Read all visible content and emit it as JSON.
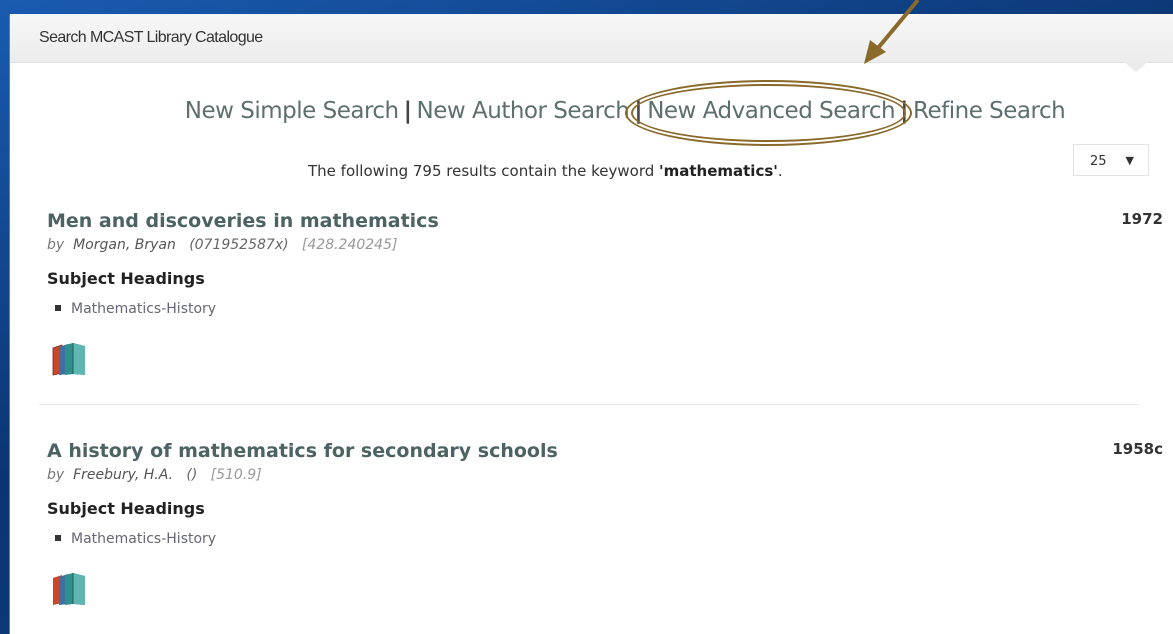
{
  "header": {
    "title": "Search MCAST Library Catalogue"
  },
  "search_links": [
    "New Simple Search",
    "New Author Search",
    "New Advanced Search",
    "Refine Search"
  ],
  "separator": "|",
  "summary": {
    "prefix": "The following 795 results contain the keyword ",
    "keyword": "'mathematics'",
    "suffix": "."
  },
  "per_page": {
    "value": "25",
    "arrow": "▼"
  },
  "subject_heading_label": "Subject Headings",
  "records": [
    {
      "title": "Men and discoveries in mathematics",
      "year": "1972",
      "by": "by",
      "author": "Morgan, Bryan",
      "isbn": "(071952587x)",
      "call_number": "[428.240245]",
      "subject": "Mathematics-History",
      "icon": "books-icon"
    },
    {
      "title": "A history of mathematics for secondary schools",
      "year": "1958c",
      "by": "by",
      "author": "Freebury, H.A.",
      "isbn": "()",
      "call_number": "[510.9]",
      "subject": "Mathematics-History",
      "icon": "books-icon"
    }
  ],
  "colors": {
    "frame": "#0e3f82",
    "link": "#5e6f6f",
    "title": "#4d6363",
    "callout": "#8a6a2a"
  }
}
